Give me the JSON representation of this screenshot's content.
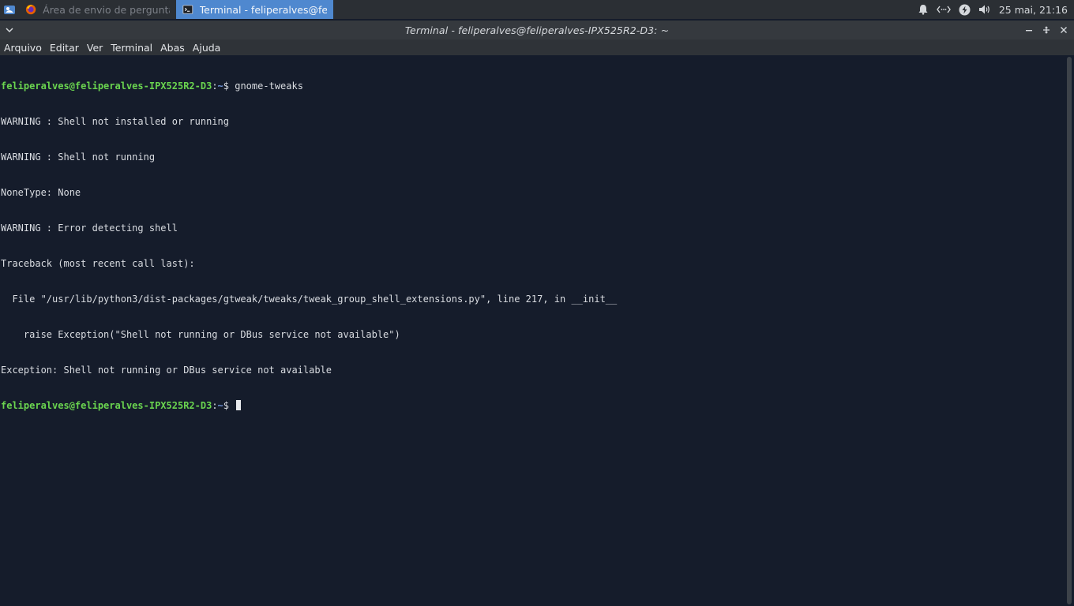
{
  "panel": {
    "tasks": [
      {
        "label": "Área de envio de perguntas -",
        "icon": "firefox-icon",
        "active": false
      },
      {
        "label": "Terminal - feliperalves@felip...",
        "icon": "terminal-icon",
        "active": true
      }
    ],
    "clock": "25 mai, 21:16"
  },
  "window": {
    "title": "Terminal - feliperalves@feliperalves-IPX525R2-D3: ~"
  },
  "menu": [
    "Arquivo",
    "Editar",
    "Ver",
    "Terminal",
    "Abas",
    "Ajuda"
  ],
  "terminal": {
    "prompt_user": "feliperalves@feliperalves-IPX525R2-D3",
    "prompt_sep": ":",
    "prompt_path": "~",
    "prompt_dollar": "$ ",
    "command": "gnome-tweaks",
    "output": [
      "WARNING : Shell not installed or running",
      "WARNING : Shell not running",
      "NoneType: None",
      "WARNING : Error detecting shell",
      "Traceback (most recent call last):",
      "  File \"/usr/lib/python3/dist-packages/gtweak/tweaks/tweak_group_shell_extensions.py\", line 217, in __init__",
      "    raise Exception(\"Shell not running or DBus service not available\")",
      "Exception: Shell not running or DBus service not available"
    ]
  },
  "colors": {
    "panel_bg": "#2b2f34",
    "active_task": "#4f88cf",
    "terminal_bg": "#151c2b",
    "prompt_user": "#6ad44f",
    "prompt_path": "#6f93d8"
  }
}
